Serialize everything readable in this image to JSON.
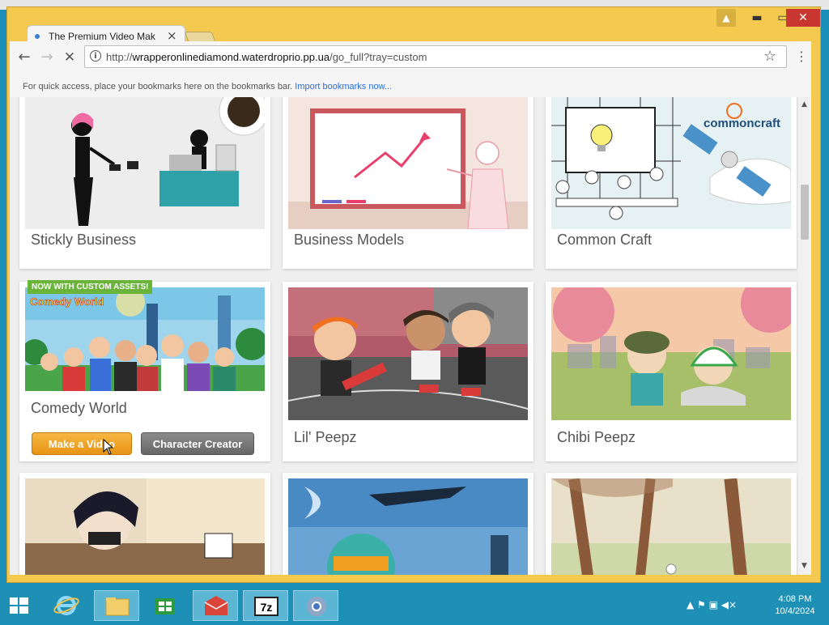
{
  "browser": {
    "tab_title": "The Premium Video Mak",
    "tab_close": "×",
    "window_user": "▲",
    "window_min": "▬",
    "window_max": "▭",
    "window_close": "✕",
    "back": "←",
    "forward": "→",
    "stop": "✕",
    "info": "i",
    "url_scheme": "http://",
    "url_host": "wrapperonlinediamond.waterdroprio.pp.ua",
    "url_path": "/go_full?tray=custom",
    "star": "☆",
    "menu": "⋮",
    "bookmarks_hint": "For quick access, place your bookmarks here on the bookmarks bar.",
    "import_bookmarks": "Import bookmarks now..."
  },
  "themes": [
    {
      "title": "Stickly Business"
    },
    {
      "title": "Business Models"
    },
    {
      "title": "Common Craft",
      "logo": "commoncraft"
    },
    {
      "title": "Comedy World",
      "badge": "NOW WITH CUSTOM ASSETS!",
      "logo": "Comedy World",
      "make_video": "Make a Video",
      "character_creator": "Character Creator"
    },
    {
      "title": "Lil' Peepz"
    },
    {
      "title": "Chibi Peepz"
    }
  ],
  "scrollbar": {
    "up": "▲",
    "down": "▼"
  },
  "taskbar": {
    "tray": "▲  ⚑  ▣  ◀×",
    "time": "4:08 PM",
    "date": "10/4/2024"
  },
  "colors": {
    "window_frame": "#f3c94f",
    "taskbar": "#1e8fb5",
    "make_video": "#f0a52a",
    "link": "#2a6ed6"
  }
}
